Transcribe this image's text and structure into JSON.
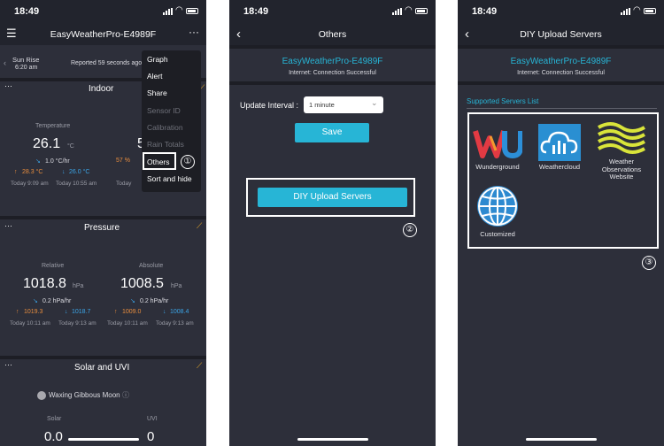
{
  "status": {
    "time": "18:49"
  },
  "screen1": {
    "title": "EasyWeatherPro-E4989F",
    "sunrise_label": "Sun Rise",
    "sunrise_time": "6:20 am",
    "reported": "Reported 59 seconds ago",
    "indoor": {
      "title": "Indoor",
      "temp_label": "Temperature",
      "temp_value": "26.1",
      "temp_unit": "°C",
      "temp_rate": "1.0 °C/hr",
      "temp_high": "28.3 °C",
      "temp_low": "26.0 °C",
      "temp_high_time": "Today 9:09 am",
      "temp_low_time": "Today 10:55 am",
      "hum_value_partial": "5",
      "hum_high_partial": "57 %",
      "hum_high_time_partial": "Today"
    },
    "pressure": {
      "title": "Pressure",
      "rel_label": "Relative",
      "abs_label": "Absolute",
      "rel_value": "1018.8",
      "abs_value": "1008.5",
      "unit": "hPa",
      "rel_rate": "0.2 hPa/hr",
      "abs_rate": "0.2 hPa/hr",
      "rel_high": "1019.3",
      "rel_low": "1018.7",
      "abs_high": "1009.0",
      "abs_low": "1008.4",
      "rel_high_time": "Today 10:11 am",
      "rel_low_time": "Today 9:13 am",
      "abs_high_time": "Today 10:11 am",
      "abs_low_time": "Today 9:13 am"
    },
    "solar": {
      "title": "Solar and UVI",
      "moon": "Waxing Gibbous Moon",
      "solar_label": "Solar",
      "uvi_label": "UVI",
      "solar_value": "0.0",
      "uvi_value": "0"
    },
    "menu": [
      "Graph",
      "Alert",
      "Share",
      "Sensor ID",
      "Calibration",
      "Rain Totals",
      "Others",
      "Sort and hide"
    ],
    "callout": "①"
  },
  "screen2": {
    "title": "Others",
    "device": "EasyWeatherPro-E4989F",
    "internet": "Internet: Connection Successful",
    "interval_label": "Update Interval :",
    "interval_value": "1 minute",
    "save": "Save",
    "diy": "DIY Upload Servers",
    "callout": "②"
  },
  "screen3": {
    "title": "DIY Upload Servers",
    "device": "EasyWeatherPro-E4989F",
    "internet": "Internet: Connection Successful",
    "list_title": "Supported Servers List",
    "servers": [
      "Wunderground",
      "Weathercloud",
      "Weather Observations Website",
      "Customized"
    ],
    "callout": "③"
  },
  "colors": {
    "accent": "#27b5d6",
    "background": "#2d2f3a",
    "high": "#e88d3e",
    "low": "#3ba4e6",
    "wu_red": "#e23a43",
    "wow_yellow": "#d9e43a"
  }
}
